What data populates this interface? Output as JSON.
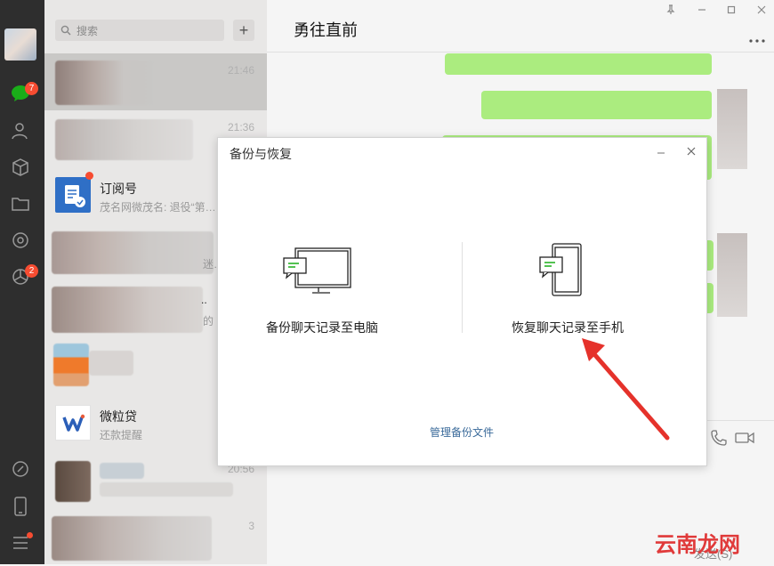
{
  "nav": {
    "chat_badge": "7",
    "moments_badge": "2"
  },
  "search": {
    "placeholder": "搜索"
  },
  "chat_list": [
    {
      "name": "",
      "preview": "",
      "time": "21:46"
    },
    {
      "name": "",
      "preview": "",
      "time": "21:36"
    },
    {
      "name": "订阅号",
      "preview": "茂名网微茂名: 退役“第…",
      "time": ""
    },
    {
      "name": "",
      "preview": "迷…",
      "time": ""
    },
    {
      "name": "..",
      "preview": "的",
      "time": ""
    },
    {
      "name": "",
      "preview": "",
      "time": ""
    },
    {
      "name": "微粒贷",
      "preview": "还款提醒",
      "time": ""
    },
    {
      "name": "",
      "preview": "",
      "time": "20:56"
    },
    {
      "name": "",
      "preview": "",
      "time": "3"
    }
  ],
  "chat": {
    "title": "勇往直前",
    "send_label": "发送(S)"
  },
  "modal": {
    "title": "备份与恢复",
    "backup_label": "备份聊天记录至电脑",
    "restore_label": "恢复聊天记录至手机",
    "manage_label": "管理备份文件"
  },
  "watermark": "云南龙网",
  "colors": {
    "accent_green": "#9eea6a",
    "badge_red": "#f74c31",
    "link_blue": "#3a6a9a"
  }
}
